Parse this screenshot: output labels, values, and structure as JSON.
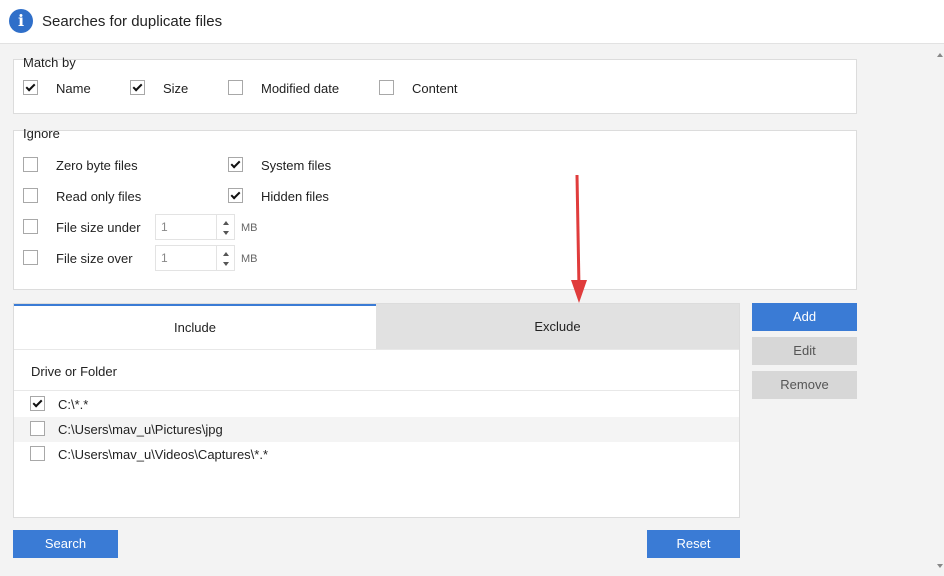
{
  "window": {
    "title": "Searches for duplicate files"
  },
  "match_by": {
    "label": "Match by",
    "options": [
      {
        "label": "Name",
        "checked": true
      },
      {
        "label": "Size",
        "checked": true
      },
      {
        "label": "Modified date",
        "checked": false
      },
      {
        "label": "Content",
        "checked": false
      }
    ]
  },
  "ignore": {
    "label": "Ignore",
    "zero_byte": {
      "label": "Zero byte files",
      "checked": false
    },
    "read_only": {
      "label": "Read only files",
      "checked": false
    },
    "size_under": {
      "label": "File size under",
      "checked": false,
      "value": "1",
      "unit": "MB"
    },
    "size_over": {
      "label": "File size over",
      "checked": false,
      "value": "1",
      "unit": "MB"
    },
    "system": {
      "label": "System files",
      "checked": true
    },
    "hidden": {
      "label": "Hidden files",
      "checked": true
    }
  },
  "tabs": {
    "include": "Include",
    "exclude": "Exclude",
    "active": "include"
  },
  "list": {
    "header": "Drive or Folder",
    "rows": [
      {
        "path": "C:\\*.*",
        "checked": true
      },
      {
        "path": "C:\\Users\\mav_u\\Pictures\\jpg",
        "checked": false
      },
      {
        "path": "C:\\Users\\mav_u\\Videos\\Captures\\*.*",
        "checked": false
      }
    ]
  },
  "side_buttons": {
    "add": "Add",
    "edit": "Edit",
    "remove": "Remove"
  },
  "footer": {
    "search": "Search",
    "reset": "Reset"
  },
  "colors": {
    "accent": "#3a7bd5",
    "annotation_arrow": "#e03c3c"
  }
}
